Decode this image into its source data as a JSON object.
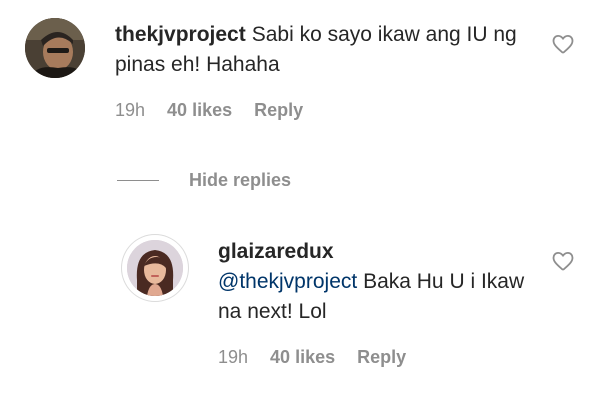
{
  "comment": {
    "username": "thekjvproject",
    "text": "Sabi ko sayo ikaw ang IU ng pinas eh! Hahaha",
    "time": "19h",
    "likes": "40 likes",
    "reply_label": "Reply"
  },
  "hide_replies_label": "Hide replies",
  "reply": {
    "username": "glaizaredux",
    "mention": "@thekjvproject",
    "text": "Baka Hu U i  Ikaw na next! Lol",
    "time": "19h",
    "likes": "40 likes",
    "reply_label": "Reply"
  },
  "icons": {
    "like": "heart-outline-icon"
  },
  "colors": {
    "text": "#262626",
    "secondary": "#8e8e8e",
    "mention": "#003569"
  }
}
